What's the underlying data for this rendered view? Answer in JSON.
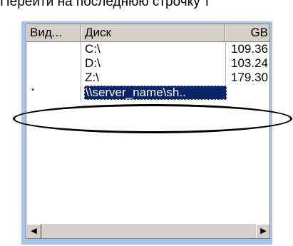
{
  "caption": "Перейти на последнюю строчку т",
  "table": {
    "columns": [
      "Вид...",
      "Диск",
      "GB"
    ],
    "rows": [
      {
        "kind": "",
        "disk": "C:\\",
        "gb": "109.36"
      },
      {
        "kind": "",
        "disk": "D:\\",
        "gb": "103.24"
      },
      {
        "kind": "",
        "disk": "Z:\\",
        "gb": "179.30"
      }
    ],
    "new_row": {
      "marker": "*",
      "disk": "\\\\server_name\\sh..",
      "gb": ""
    }
  },
  "scrollbar": {
    "left_arrow": "◀",
    "right_arrow": "▶"
  },
  "colors": {
    "panel": "#a7c5ea",
    "selection": "#0a246a",
    "highlight_ring": "#000000"
  }
}
